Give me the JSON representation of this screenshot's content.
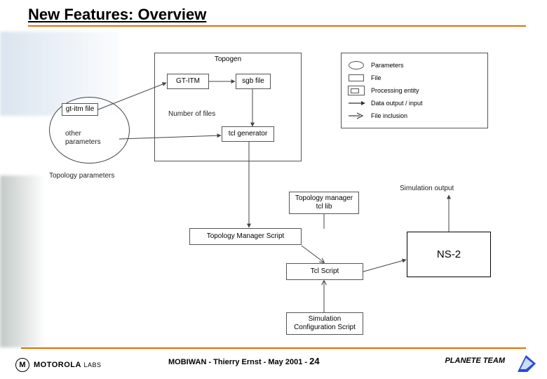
{
  "title": "New Features: Overview",
  "diagram": {
    "topogen_container_label": "Topogen",
    "gt_itm": "GT-ITM",
    "sgb_file": "sgb file",
    "gt_itm_file": "gt-itm file",
    "other_params": "other\nparameters",
    "topology_parameters": "Topology parameters",
    "number_of_files": "Number of files",
    "tcl_generator": "tcl generator",
    "topology_manager_tcl_lib": "Topology manager\ntcl lib",
    "topology_manager_script": "Topology Manager Script",
    "tcl_script": "Tcl Script",
    "simulation_config_script": "Simulation\nConfiguration Script",
    "simulation_output": "Simulation output",
    "ns2": "NS-2"
  },
  "legend": {
    "parameters": "Parameters",
    "file": "File",
    "processing_entity": "Processing entity",
    "data_output_input": "Data output / input",
    "file_inclusion": "File inclusion"
  },
  "footer": {
    "moto_brand": "MOTOROLA",
    "moto_labs": "LABS",
    "center": "MOBIWAN - Thierry Ernst - May 2001 -",
    "page_number": "24",
    "planete": "PLANETE TEAM"
  }
}
